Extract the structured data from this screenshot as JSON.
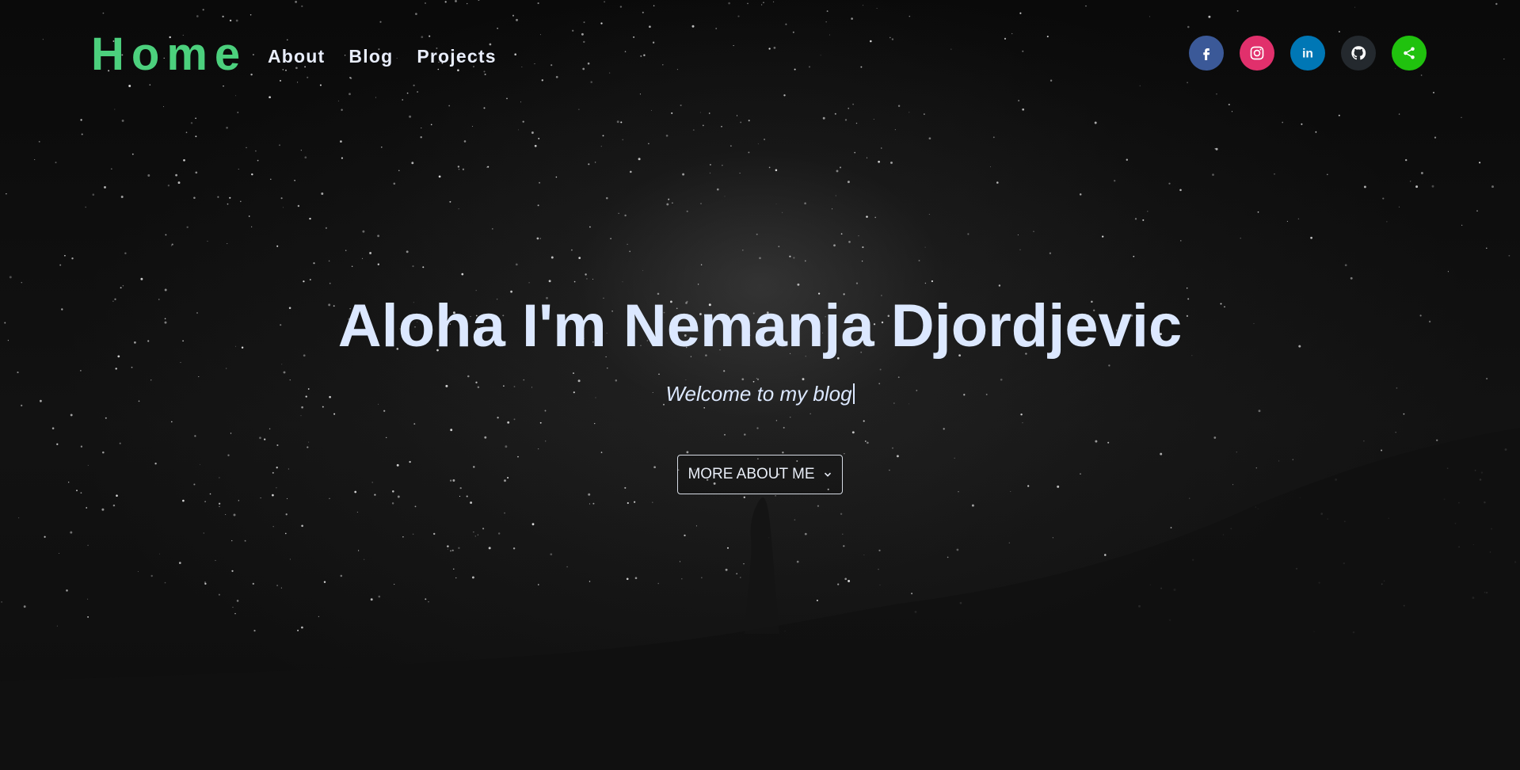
{
  "nav": {
    "brand": "Home",
    "links": [
      "About",
      "Blog",
      "Projects"
    ]
  },
  "social": [
    {
      "name": "facebook-icon",
      "color": "#3b5998"
    },
    {
      "name": "instagram-icon",
      "color": "#e1306c"
    },
    {
      "name": "linkedin-icon",
      "color": "#0077b5"
    },
    {
      "name": "github-icon",
      "color": "#24292e"
    },
    {
      "name": "share-icon",
      "color": "#20c20e"
    }
  ],
  "hero": {
    "title": "Aloha I'm Nemanja Djordjevic",
    "subtitle": "Welcome to my blog",
    "button_label": "MORE ABOUT ME"
  },
  "colors": {
    "brand_green": "#4cd07d",
    "title": "#dce8ff",
    "background": "#0b0b0b"
  }
}
